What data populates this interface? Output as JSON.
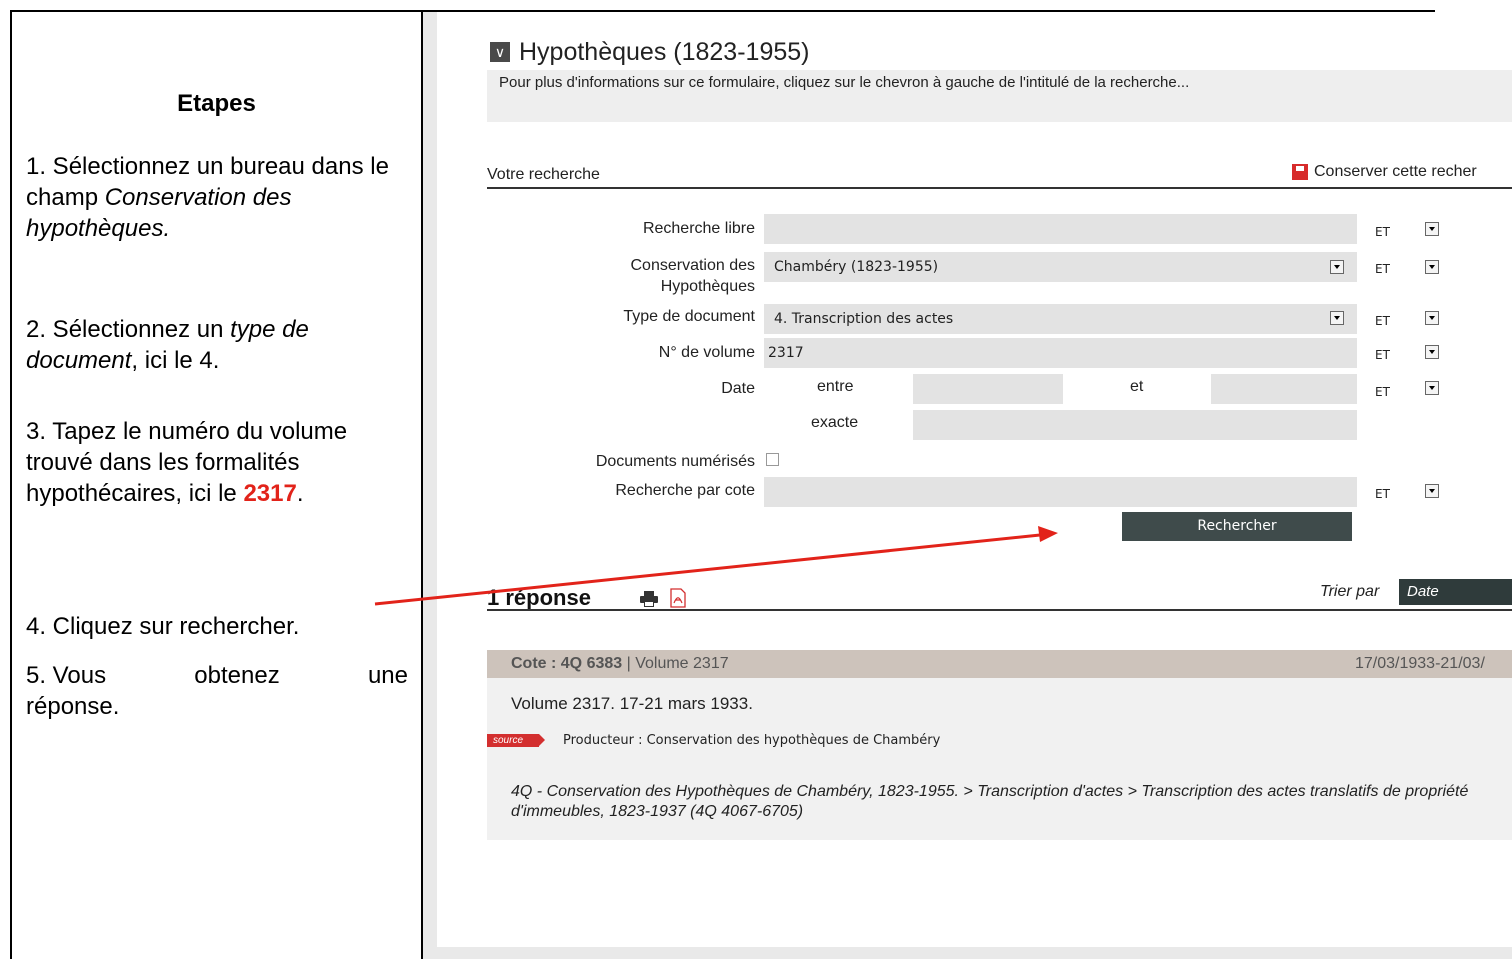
{
  "instructions": {
    "title": "Etapes",
    "step1_prefix": "1. Sélectionnez un bureau dans le champ ",
    "step1_em": "Conservation des hypothèques.",
    "step2_prefix": "2. Sélectionnez un ",
    "step2_em": "type de document",
    "step2_suffix": ", ici le 4.",
    "step3_prefix": "3. Tapez le numéro du volume trouvé dans les formalités hypothécaires, ici le ",
    "step3_number": "2317",
    "step3_suffix": ".",
    "step4": "4. Cliquez sur rechercher.",
    "step5_words": [
      "5. Vous",
      "obtenez",
      "une"
    ],
    "step5_line2": "réponse."
  },
  "form": {
    "title": "Hypothèques (1823-1955)",
    "chevron": "∨",
    "subtitle": "Pour plus d'informations sur ce formulaire, cliquez sur le chevron à gauche de l'intitulé de la recherche...",
    "section_label": "Votre recherche",
    "save_search": "Conserver cette recher",
    "fields": {
      "free_search_label": "Recherche libre",
      "conservation_label_1": "Conservation des",
      "conservation_label_2": "Hypothèques",
      "conservation_value": "Chambéry (1823-1955)",
      "doctype_label": "Type de document",
      "doctype_value": "4. Transcription des actes",
      "volume_label": "N° de volume",
      "volume_value": "2317",
      "date_label": "Date",
      "date_between": "entre",
      "date_and": "et",
      "date_exact": "exacte",
      "digitized_label": "Documents numérisés",
      "cote_label": "Recherche par cote"
    },
    "operator": "ET",
    "search_button": "Rechercher"
  },
  "results": {
    "count_label": "1 réponse",
    "sort_label": "Trier par",
    "sort_value": "Date",
    "item": {
      "cote_label": "Cote : 4Q 6383",
      "volume": " | Volume 2317",
      "dates": "17/03/1933-21/03/",
      "title": "Volume 2317. 17-21 mars 1933.",
      "badge": "source",
      "producer": "Producteur : Conservation des hypothèques de Chambéry",
      "path": "4Q - Conservation des Hypothèques de Chambéry, 1823-1955. > Transcription d'actes > Transcription des actes translatifs de propriété d'immeubles, 1823-1937 (4Q 4067-6705)"
    }
  },
  "colors": {
    "accent_red": "#e2231a",
    "button_dark": "#3f4b4b",
    "result_header": "#cdc3bb",
    "field_bg": "#e3e3e3"
  }
}
